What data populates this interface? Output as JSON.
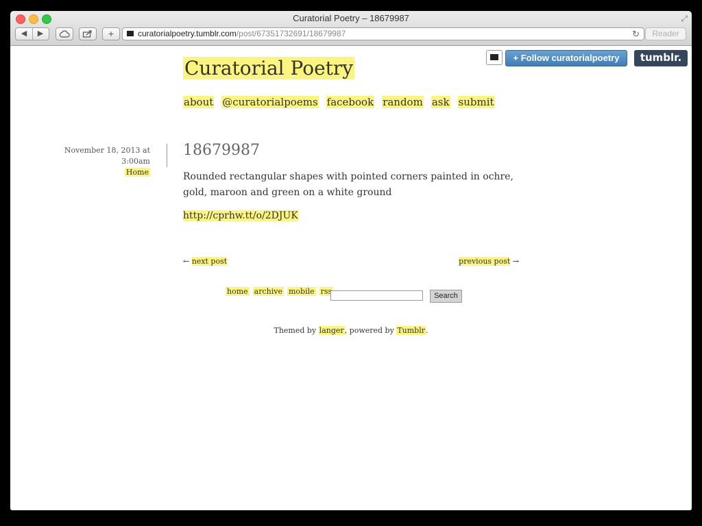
{
  "browser": {
    "window_title": "Curatorial Poetry – 18679987",
    "back_icon": "◀",
    "forward_icon": "▶",
    "address_host": "curatorialpoetry.tumblr.com",
    "address_path": "/post/67351732691/18679987",
    "reader_label": "Reader"
  },
  "tumblr_bar": {
    "follow_label": "+ Follow curatorialpoetry",
    "logo_label": "tumblr."
  },
  "blog": {
    "title": "Curatorial Poetry",
    "nav": [
      "about",
      "@curatorialpoems",
      "facebook",
      "random",
      "ask",
      "submit"
    ]
  },
  "post": {
    "date": "November 18, 2013 at 3:00am",
    "home_label": "Home",
    "title": "18679987",
    "body": "Rounded rectangular shapes with pointed corners painted in ochre, gold, maroon and green on a white ground",
    "link": "http://cprhw.tt/o/2DJUK"
  },
  "pager": {
    "next_arrow": "←",
    "next_label": "next post",
    "prev_label": "previous post",
    "prev_arrow": "→"
  },
  "footer": {
    "links": [
      "home",
      "archive",
      "mobile",
      "rss"
    ],
    "search_value": "",
    "search_button": "Search",
    "themed_by_prefix": "Themed by",
    "theme_author": "langer",
    "powered_by": ", powered by",
    "platform": "Tumblr",
    "suffix": "."
  }
}
